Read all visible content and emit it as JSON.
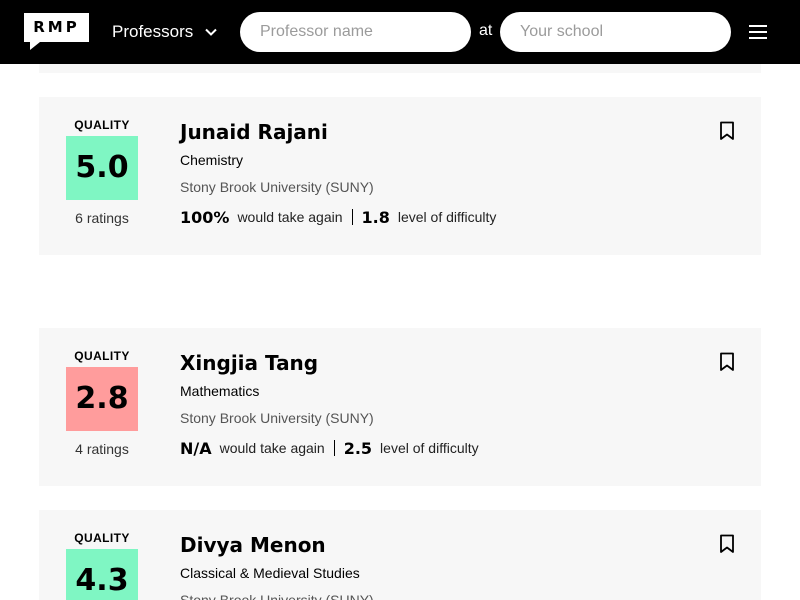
{
  "header": {
    "logo_text": "RMP",
    "type_select_label": "Professors",
    "search_name_placeholder": "Professor name",
    "at_label": "at",
    "search_school_placeholder": "Your school",
    "icons": {
      "dropdown": "chevron-down-icon",
      "menu": "hamburger-menu-icon",
      "bookmark": "bookmark-icon"
    }
  },
  "professors": [
    {
      "quality_label": "QUALITY",
      "rating": "5.0",
      "rating_color": "#7ff6c3",
      "ratings_count": "6 ratings",
      "name": "Junaid Rajani",
      "department": "Chemistry",
      "school": "Stony Brook University (SUNY)",
      "take_again": "100%",
      "take_again_label": "would take again",
      "difficulty": "1.8",
      "difficulty_label": "level of difficulty"
    },
    {
      "quality_label": "QUALITY",
      "rating": "2.8",
      "rating_color": "#ff9c9c",
      "ratings_count": "4 ratings",
      "name": "Xingjia Tang",
      "department": "Mathematics",
      "school": "Stony Brook University (SUNY)",
      "take_again": "N/A",
      "take_again_label": "would take again",
      "difficulty": "2.5",
      "difficulty_label": "level of difficulty"
    },
    {
      "quality_label": "QUALITY",
      "rating": "4.3",
      "rating_color": "#7ff6c3",
      "name": "Divya Menon",
      "department": "Classical & Medieval Studies",
      "school": "Stony Brook University (SUNY)"
    }
  ]
}
